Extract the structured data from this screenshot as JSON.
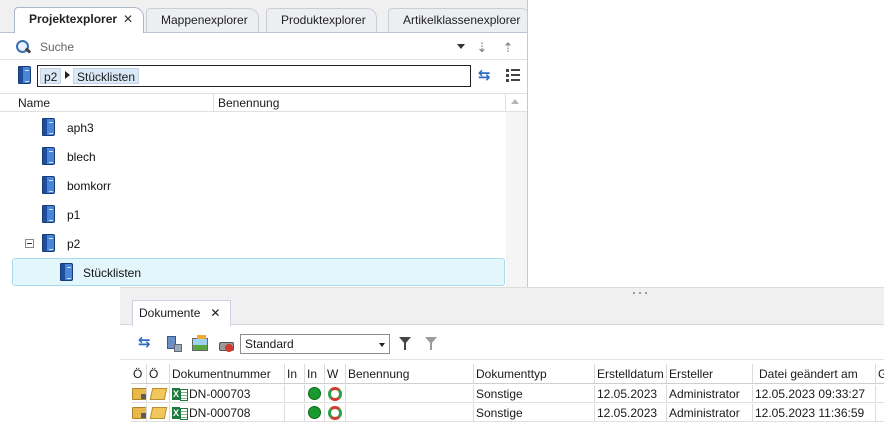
{
  "explorer": {
    "tabs": [
      {
        "label": "Projektexplorer",
        "close": "✕"
      },
      {
        "label": "Mappenexplorer"
      },
      {
        "label": "Produktexplorer"
      },
      {
        "label": "Artikelklassenexplorer"
      }
    ],
    "search_placeholder": "Suche",
    "path": [
      "p2",
      "Stücklisten"
    ],
    "columns": [
      "Name",
      "Benennung"
    ],
    "tree": [
      {
        "label": "aph3"
      },
      {
        "label": "blech"
      },
      {
        "label": "bomkorr"
      },
      {
        "label": "p1"
      },
      {
        "label": "p2"
      },
      {
        "label": "Stücklisten"
      }
    ]
  },
  "documents": {
    "tab_label": "Dokumente",
    "tab_close": "✕",
    "view_selected": "Standard",
    "columns": [
      "Ö",
      "Ö",
      "Dokumentnummer",
      "In",
      "In",
      "W",
      "Benennung",
      "Dokumenttyp",
      "Erstelldatum",
      "Ersteller",
      "Datei geändert am",
      "G"
    ],
    "rows": [
      {
        "number": "DN-000703",
        "benennung": "",
        "type": "Sonstige",
        "created": "12.05.2023",
        "creator": "Administrator",
        "modified": "12.05.2023 09:33:27"
      },
      {
        "number": "DN-000708",
        "benennung": "",
        "type": "Sonstige",
        "created": "12.05.2023",
        "creator": "Administrator",
        "modified": "12.05.2023 11:36:59"
      }
    ]
  },
  "colors": {
    "accent_blue": "#2e6cc4",
    "selection_bg": "#e3f6fb",
    "status_green": "#1a9a2e"
  }
}
